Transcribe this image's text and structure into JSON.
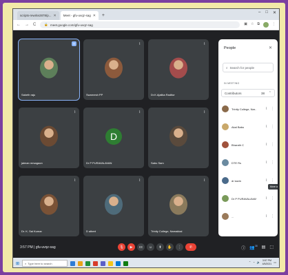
{
  "browser": {
    "tabs": [
      {
        "label": "scripts-rewrite2878/p..."
      },
      {
        "label": "Meet - gfu-uvqz-sag"
      }
    ],
    "new_tab": "+",
    "window_controls": [
      "–",
      "□",
      "✕"
    ],
    "nav": [
      "←",
      "→",
      "C"
    ],
    "url": "meet.google.com/gfu-uvqz-sag"
  },
  "tiles": [
    {
      "name": "Saketh raju",
      "speaking": true,
      "pinned": true,
      "kind": "photo",
      "color": "#5d7f5a"
    },
    {
      "name": "Swarnesh PP",
      "kind": "photo",
      "color": "#8c5a3c"
    },
    {
      "name": "Dr.K.Ajailka Raditor",
      "kind": "photo",
      "color": "#a34c4c"
    },
    {
      "name": "jaiman mrsagaon",
      "kind": "photo",
      "color": "#6b4a33"
    },
    {
      "name": "Dr P PURAVALAVAN",
      "kind": "letter",
      "letter": "D"
    },
    {
      "name": "Sabu Sam",
      "kind": "photo",
      "color": "#5a4a3c"
    },
    {
      "name": "Dr. K. Sai Kumar",
      "kind": "photo",
      "color": "#7a5236"
    },
    {
      "name": "D albert",
      "kind": "photo",
      "color": "#4e6b7a"
    },
    {
      "name": "Trinity College, Namakkal",
      "kind": "photo",
      "color": "#8a7a5c"
    }
  ],
  "panel": {
    "title": "People",
    "search_placeholder": "Search for people",
    "section_caption": "IN MEETING",
    "group_label": "Contributors",
    "group_count": "38",
    "tooltip": "More actions",
    "people": [
      {
        "name": "Trinity College, Nar...(You)"
      },
      {
        "name": "Akal Babu"
      },
      {
        "name": "Bharath C"
      },
      {
        "name": "DTE Rs"
      },
      {
        "name": "dr kavin"
      },
      {
        "name": "Dr P PURAVALAVAN"
      },
      {
        "name": "..."
      }
    ]
  },
  "controls": {
    "time": "3:57 PM",
    "separator": "|",
    "meeting_code": "gfu-uvqz-sag",
    "icons": [
      "mic-icon",
      "camera-icon",
      "captions-icon",
      "emoji-icon",
      "present-icon",
      "raise-hand-icon",
      "more-icon"
    ],
    "right_icons": [
      "info-icon",
      "people-icon",
      "chat-icon",
      "activities-icon"
    ],
    "people_count": "38"
  },
  "taskbar": {
    "search_placeholder": "Type here to search",
    "time": "3:57 PM",
    "date": "4/5/2021",
    "app_colors": [
      "#2d7cd6",
      "#e8a31a",
      "#1f8f3a",
      "#d83b2b",
      "#5b5fc7",
      "#f5c518",
      "#0078d4",
      "#107c10"
    ]
  }
}
